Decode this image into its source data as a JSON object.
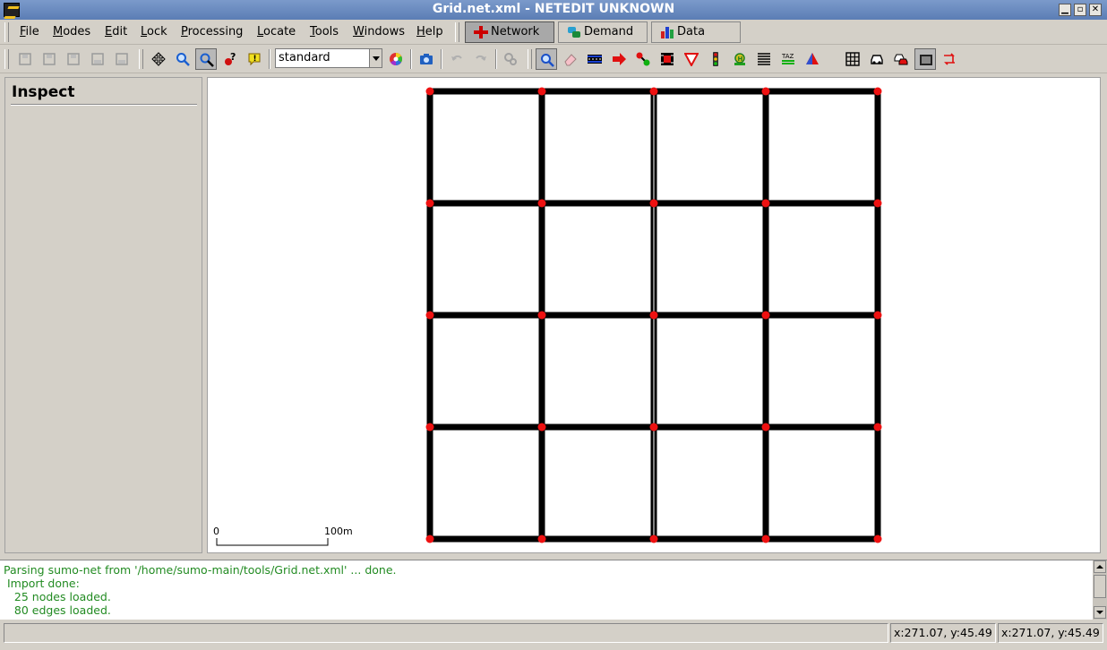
{
  "window": {
    "title": "Grid.net.xml - NETEDIT UNKNOWN"
  },
  "menu": {
    "items": [
      {
        "label": "File",
        "mnemonic": "F",
        "rest": "ile"
      },
      {
        "label": "Modes",
        "mnemonic": "M",
        "rest": "odes"
      },
      {
        "label": "Edit",
        "mnemonic": "E",
        "rest": "dit"
      },
      {
        "label": "Lock",
        "mnemonic": "L",
        "rest": "ock"
      },
      {
        "label": "Processing",
        "mnemonic": "P",
        "rest": "rocessing"
      },
      {
        "label": "Locate",
        "mnemonic": "L",
        "rest": "ocate"
      },
      {
        "label": "Tools",
        "mnemonic": "T",
        "rest": "ools"
      },
      {
        "label": "Windows",
        "mnemonic": "W",
        "rest": "indows"
      },
      {
        "label": "Help",
        "mnemonic": "H",
        "rest": "elp"
      }
    ]
  },
  "supermodes": {
    "network": "Network",
    "demand": "Demand",
    "data": "Data",
    "active": "Network"
  },
  "toolbar": {
    "scheme_value": "standard"
  },
  "left_panel": {
    "heading": "Inspect"
  },
  "canvas": {
    "scale_zero": "0",
    "scale_label": "100m"
  },
  "console": {
    "lines": [
      "Parsing sumo-net from '/home/sumo-main/tools/Grid.net.xml' ... done.",
      " Import done:",
      "   25 nodes loaded.",
      "   80 edges loaded."
    ]
  },
  "status": {
    "coord_left": "x:271.07, y:45.49",
    "coord_right": "x:271.07, y:45.49"
  },
  "colors": {
    "junction": "#ee1111",
    "edge": "#000000",
    "console_text": "#228b22"
  }
}
